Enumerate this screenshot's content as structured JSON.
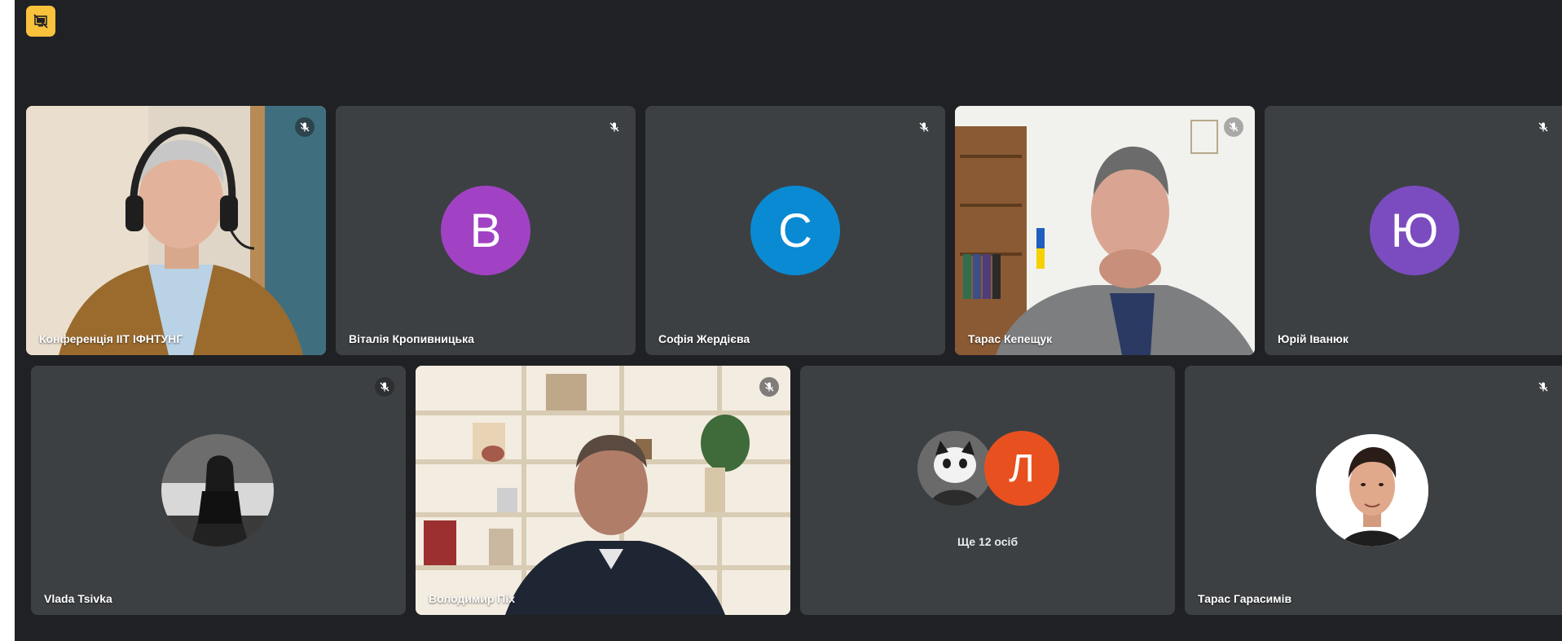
{
  "top_badge": {
    "icon": "presentation-off-icon",
    "color": "#f9c23c"
  },
  "row1": [
    {
      "name": "Конференція ІІТ ІФНТУНГ",
      "type": "video"
    },
    {
      "name": "Віталія Кропивницька",
      "type": "avatar",
      "letter": "В",
      "color": "#a142c4"
    },
    {
      "name": "Софія Жердієва",
      "type": "avatar",
      "letter": "С",
      "color": "#0b8ad4"
    },
    {
      "name": "Тарас Кепещук",
      "type": "video"
    },
    {
      "name": "Юрій Іванюк",
      "type": "avatar",
      "letter": "Ю",
      "color": "#7b4cc0"
    }
  ],
  "row2": [
    {
      "name": "Vlada Tsivka",
      "type": "photo-avatar"
    },
    {
      "name": "Володимир Піх",
      "type": "video"
    },
    {
      "name": "",
      "type": "more",
      "letter": "Л",
      "color": "#e8511f",
      "more_label": "Ще 12 осіб"
    },
    {
      "name": "Тарас Гарасимів",
      "type": "photo-avatar"
    }
  ],
  "icons": {
    "mic": "mic-off-icon"
  }
}
